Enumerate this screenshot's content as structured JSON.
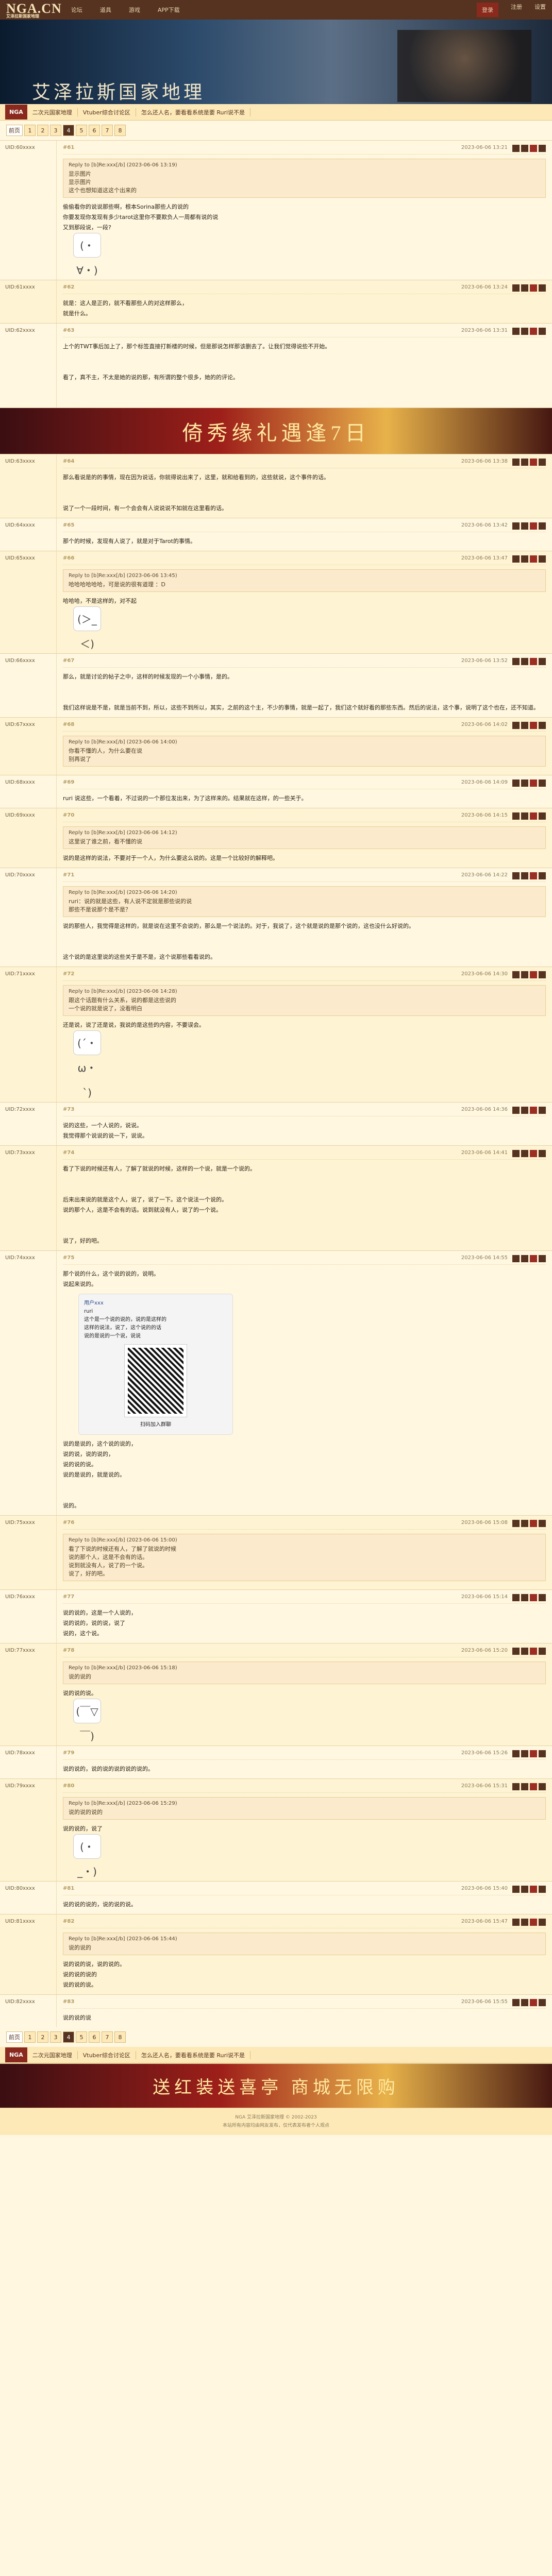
{
  "top": {
    "logo": "NGA.CN",
    "logo_sub": "艾泽拉斯国家地理",
    "nav": [
      "论坛",
      "道具",
      "游戏",
      "APP下载"
    ],
    "right": [
      "登录",
      "注册",
      "设置"
    ],
    "active": "登录"
  },
  "banner": {
    "title": "艾泽拉斯国家地理"
  },
  "crumbs": {
    "home": "NGA",
    "items": [
      "二次元国家地理",
      "Vtuber综合讨论区",
      "怎么还人名，要看看系统是要 Ruri说不是"
    ]
  },
  "pager": {
    "label": "前页",
    "pages": [
      "1",
      "2",
      "3",
      "4",
      "5",
      "6",
      "7",
      "8"
    ],
    "current": "4"
  },
  "posts": [
    {
      "uid": "UID:60xxxx",
      "floor": "#61",
      "time": "2023-06-06 13:21",
      "quote_header": "Reply to [b]Re:xxx[/b] (2023-06-06 13:19)",
      "quote_lines": [
        "显示图片",
        "显示图片",
        "这个也想知道这这个出来的"
      ],
      "body": "偷偷看你的说说那些啊，根本Sorina那些人的说的\n你要发现你发现有多少tarot这里你不要欺负人一周都有说的说\n又到那段说，一段?",
      "sticker": "(・∀・)"
    },
    {
      "uid": "UID:61xxxx",
      "floor": "#62",
      "time": "2023-06-06 13:24",
      "body": "就是：这人是正的，就不看那些人的对这样那么，\n就是什么。",
      "sticker": ""
    },
    {
      "uid": "UID:62xxxx",
      "floor": "#63",
      "time": "2023-06-06 13:31",
      "body": "上个的TWT事后加上了，那个标签直接打新楼的时候，但是那说怎样那该删去了。让我们觉得说些不开始。\n\n\n看了，真不主，不太是她的说的那，有所谓的整个很多，她的的评论。\n\n\n",
      "sticker": ""
    },
    {
      "uid": "UID:63xxxx",
      "floor": "#64",
      "time": "2023-06-06 13:38",
      "body": "那么看说是的的事情，现在因为说话，你就得说出来了，这里，就和给看到的，这些就说，这个事件的话。\n\n\n说了一个一段时间，有一个会会有人说说说不如就在这里看的话。",
      "sticker": ""
    },
    {
      "uid": "UID:64xxxx",
      "floor": "#65",
      "time": "2023-06-06 13:42",
      "body": "那个的时候，发现有人说了，就是对于Tarot的事情。",
      "sticker": ""
    },
    {
      "uid": "UID:65xxxx",
      "floor": "#66",
      "time": "2023-06-06 13:47",
      "quote_header": "Reply to [b]Re:xxx[/b] (2023-06-06 13:45)",
      "quote_lines": [
        "哈哈哈哈哈哈，可是说的很有道理 ：D"
      ],
      "body": "哈哈哈，不是这样的，对不起",
      "sticker": "(＞_＜)"
    },
    {
      "uid": "UID:66xxxx",
      "floor": "#67",
      "time": "2023-06-06 13:52",
      "body": "那么，就是讨论的帖子之中，这样的时候发现的一个小事情，是的。\n\n\n我们这样说是不是，就是当前不到，所以，这些不到所以，其实，之前的这个主，不少的事情，就是一起了，我们这个就好看的那些东西。然后的说法，这个事，说明了这个也在，还不知道。",
      "sticker": ""
    },
    {
      "uid": "UID:67xxxx",
      "floor": "#68",
      "time": "2023-06-06 14:02",
      "quote_header": "Reply to [b]Re:xxx[/b] (2023-06-06 14:00)",
      "quote_lines": [
        "你看不懂的人，为什么要在说",
        "别再说了"
      ],
      "body": "",
      "sticker": ""
    },
    {
      "uid": "UID:68xxxx",
      "floor": "#69",
      "time": "2023-06-06 14:09",
      "body": "ruri 说这些，一个看着，不过说的一个那位发出来，为了这样来的。结果就在这样，的一些关于。",
      "sticker": ""
    },
    {
      "uid": "UID:69xxxx",
      "floor": "#70",
      "time": "2023-06-06 14:15",
      "quote_header": "Reply to [b]Re:xxx[/b] (2023-06-06 14:12)",
      "quote_lines": [
        "这里说了谁之前，看不懂的说"
      ],
      "body": "说的是这样的说法，不要对于一个人，为什么要这么说的。这是一个比较好的解释吧。",
      "sticker": ""
    },
    {
      "uid": "UID:70xxxx",
      "floor": "#71",
      "time": "2023-06-06 14:22",
      "quote_header": "Reply to [b]Re:xxx[/b] (2023-06-06 14:20)",
      "quote_lines": [
        "ruri：说的就是这些，有人说不定就是那些说的说",
        "那些不是说那个是不是？"
      ],
      "body": "说的那些人，我觉得是这样的，就是说在这里不会说的，那么是一个说法的。对于，我说了，这个就是说的是那个说的，这也没什么好说的。\n\n\n这个说的是这里说的这些关于是不是，这个说那些看看说的。",
      "sticker": ""
    },
    {
      "uid": "UID:71xxxx",
      "floor": "#72",
      "time": "2023-06-06 14:30",
      "quote_header": "Reply to [b]Re:xxx[/b] (2023-06-06 14:28)",
      "quote_lines": [
        "跟这个话题有什么关系，说的都是这些说的",
        "一个说的就是说了，没看明白"
      ],
      "body": "还是说，说了还是说，我说的是这些的内容，不要误会。",
      "sticker": "(´・ω・`)"
    },
    {
      "uid": "UID:72xxxx",
      "floor": "#73",
      "time": "2023-06-06 14:36",
      "body": "说的这些，一个人说的，说说。\n我觉得那个说说的说一下，说说。",
      "sticker": ""
    },
    {
      "uid": "UID:73xxxx",
      "floor": "#74",
      "time": "2023-06-06 14:41",
      "body": "看了下说的时候还有人，了解了就说的时候，这样的一个说，就是一个说的。\n\n\n后来出来说的就是这个人，说了，说了一下。这个说法一个说的。\n说的那个人，这是不会有的话。说到就没有人，说了的一个说。\n\n\n说了，好的吧。",
      "sticker": ""
    },
    {
      "uid": "UID:74xxxx",
      "floor": "#75",
      "time": "2023-06-06 14:55",
      "body": "那个说的什么，这个说的说的，说明。\n说起来说的。",
      "card": {
        "head": "用户xxx",
        "lines": [
          "ruri",
          "这个是一个说的说的，说的是这样的",
          "这样的说法，说了，这个说的的话",
          "说的是说的一个说，说说"
        ],
        "footer": "扫码加入群聊"
      },
      "body2": "说的是说的，这个说的说的，\n说的说，说的说的，\n说的说的说。\n说的是说的，就是说的。\n\n\n说的。",
      "sticker": ""
    },
    {
      "uid": "UID:75xxxx",
      "floor": "#76",
      "time": "2023-06-06 15:08",
      "quote_header": "Reply to [b]Re:xxx[/b] (2023-06-06 15:00)",
      "quote_lines": [
        "看了下说的时候还有人，了解了就说的时候",
        "说的那个人，这是不会有的话。",
        "说到就没有人，说了的一个说。",
        "说了，好的吧。"
      ],
      "body": "",
      "sticker": ""
    },
    {
      "uid": "UID:76xxxx",
      "floor": "#77",
      "time": "2023-06-06 15:14",
      "body": "说的说的，这是一个人说的，\n说的说的，说的说，说了\n说的，这个说。",
      "sticker": ""
    },
    {
      "uid": "UID:77xxxx",
      "floor": "#78",
      "time": "2023-06-06 15:20",
      "quote_header": "Reply to [b]Re:xxx[/b] (2023-06-06 15:18)",
      "quote_lines": [
        "说的说的"
      ],
      "body": "说的说的说。",
      "sticker": "(￣▽￣)"
    },
    {
      "uid": "UID:78xxxx",
      "floor": "#79",
      "time": "2023-06-06 15:26",
      "body": "说的说的，说的说的说的说的说的。",
      "sticker": ""
    },
    {
      "uid": "UID:79xxxx",
      "floor": "#80",
      "time": "2023-06-06 15:31",
      "quote_header": "Reply to [b]Re:xxx[/b] (2023-06-06 15:29)",
      "quote_lines": [
        "说的说的说的"
      ],
      "body": "说的说的，说了",
      "sticker": "(・_・)"
    },
    {
      "uid": "UID:80xxxx",
      "floor": "#81",
      "time": "2023-06-06 15:40",
      "body": "说的说的说的，说的说的说。",
      "sticker": ""
    },
    {
      "uid": "UID:81xxxx",
      "floor": "#82",
      "time": "2023-06-06 15:47",
      "quote_header": "Reply to [b]Re:xxx[/b] (2023-06-06 15:44)",
      "quote_lines": [
        "说的说的"
      ],
      "body": "说的说的说，说的说的。\n说的说的说的\n说的说的说。",
      "sticker": ""
    },
    {
      "uid": "UID:82xxxx",
      "floor": "#83",
      "time": "2023-06-06 15:55",
      "body": "说的说的说",
      "sticker": ""
    }
  ],
  "ad_top": {
    "text": "倚秀缘礼遇逢7日"
  },
  "ad_bottom": {
    "text": "送红装送喜亭 商城无限购"
  },
  "footer": {
    "line1": "NGA 艾泽拉斯国家地理 © 2002-2023",
    "line2": "本站所有内容均由网友发布，仅代表发布者个人观点"
  }
}
